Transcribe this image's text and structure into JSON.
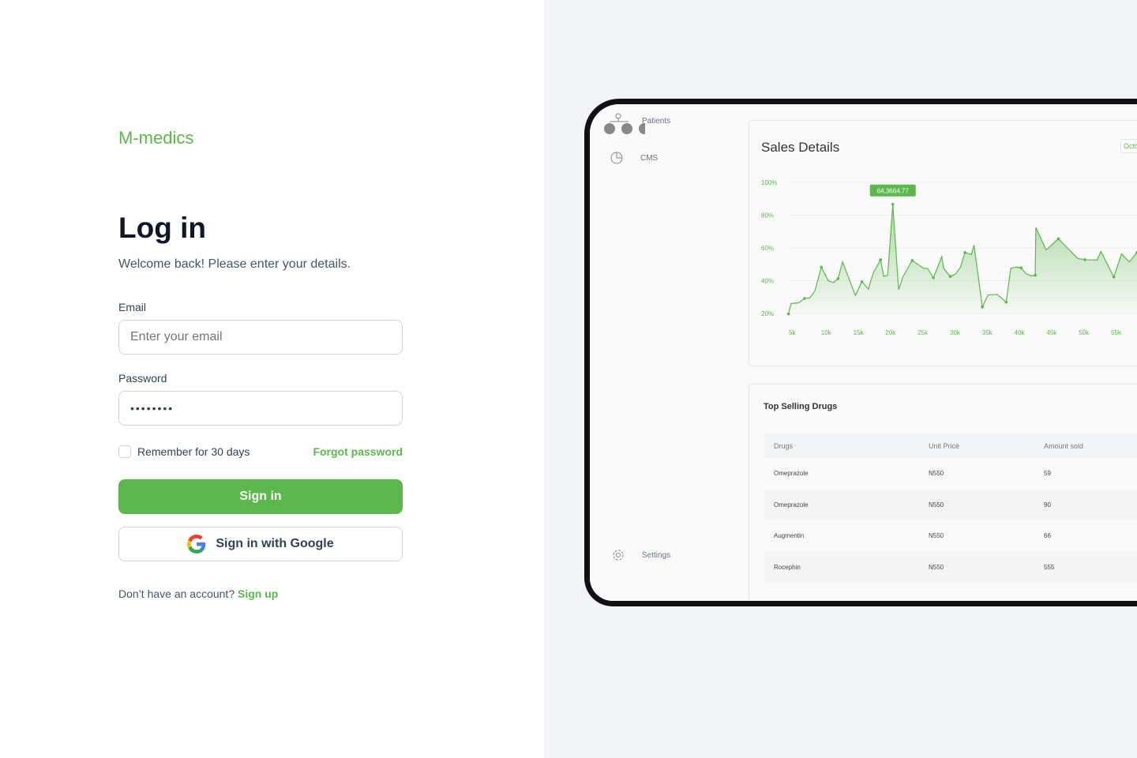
{
  "brand": "M-medics",
  "login": {
    "title": "Log in",
    "subtitle": "Welcome back! Please enter your details.",
    "email_label": "Email",
    "email_placeholder": "Enter your email",
    "password_label": "Password",
    "password_value": "••••••••",
    "remember": "Remember for 30 days",
    "forgot": "Forgot password",
    "signin": "Sign in",
    "google": "Sign in with Google",
    "no_account": "Don’t have an account?",
    "signup": "Sign up"
  },
  "preview": {
    "sidebar": [
      "Patients",
      "CMS",
      "Settings"
    ],
    "sales_title": "Sales Details",
    "month_select": "Octo",
    "table_title": "Top Selling Drugs",
    "columns": [
      "Drugs",
      "Unit Price",
      "Amount sold"
    ],
    "rows": [
      [
        "Omeprazole",
        "N550",
        "59"
      ],
      [
        "Omeprazole",
        "N550",
        "90"
      ],
      [
        "Augmentin",
        "N550",
        "66"
      ],
      [
        "Rocephin",
        "N550",
        "555"
      ]
    ]
  },
  "chart_data": {
    "type": "area",
    "title": "Sales Details",
    "xlabel": "",
    "ylabel": "",
    "xlim": [
      5,
      60
    ],
    "ylim": [
      20,
      100
    ],
    "x_ticks": [
      "5k",
      "10k",
      "15k",
      "20k",
      "25k",
      "30k",
      "35k",
      "40k",
      "45k",
      "50k",
      "55k"
    ],
    "y_ticks": [
      "100%",
      "80%",
      "60%",
      "40%",
      "20%"
    ],
    "tooltip": "64,3664.77",
    "color": "#5cb84c",
    "points": [
      [
        4.7,
        19.7
      ],
      [
        5.1,
        26.1
      ],
      [
        6.3,
        26.5
      ],
      [
        7.2,
        29.2
      ],
      [
        8.0,
        29.5
      ],
      [
        8.8,
        33.7
      ],
      [
        9.8,
        48.3
      ],
      [
        10.9,
        39.9
      ],
      [
        11.7,
        38.9
      ],
      [
        12.4,
        41.3
      ],
      [
        13.1,
        51.5
      ],
      [
        15.1,
        31.0
      ],
      [
        16.1,
        39.4
      ],
      [
        17.1,
        34.9
      ],
      [
        17.9,
        45.0
      ],
      [
        19.0,
        52.8
      ],
      [
        19.5,
        42.6
      ],
      [
        20.1,
        43.4
      ],
      [
        20.9,
        86.6
      ],
      [
        21.8,
        34.5
      ],
      [
        22.5,
        42.6
      ],
      [
        23.9,
        52.3
      ],
      [
        25.7,
        47.5
      ],
      [
        26.3,
        47.5
      ],
      [
        27.2,
        41.8
      ],
      [
        28.5,
        54.7
      ],
      [
        28.8,
        47.5
      ],
      [
        29.8,
        42.6
      ],
      [
        30.7,
        44.2
      ],
      [
        31.4,
        48.3
      ],
      [
        32.1,
        57.2
      ],
      [
        33.1,
        55.9
      ],
      [
        33.5,
        61.7
      ],
      [
        34.8,
        24.0
      ],
      [
        35.7,
        31.3
      ],
      [
        37.1,
        31.6
      ],
      [
        38.5,
        26.9
      ],
      [
        39.2,
        47.5
      ],
      [
        40.0,
        48.3
      ],
      [
        40.8,
        47.8
      ],
      [
        41.6,
        44.2
      ],
      [
        42.5,
        42.9
      ],
      [
        43.0,
        43.4
      ],
      [
        43.1,
        72.5
      ],
      [
        44.7,
        58.8
      ],
      [
        46.6,
        65.6
      ],
      [
        47.9,
        60.4
      ],
      [
        49.6,
        53.6
      ],
      [
        50.7,
        52.8
      ],
      [
        52.6,
        52.6
      ],
      [
        53.2,
        57.8
      ],
      [
        55.2,
        42.3
      ],
      [
        56.4,
        56.3
      ],
      [
        57.6,
        51.5
      ],
      [
        58.8,
        57.2
      ],
      [
        60,
        50
      ]
    ]
  }
}
